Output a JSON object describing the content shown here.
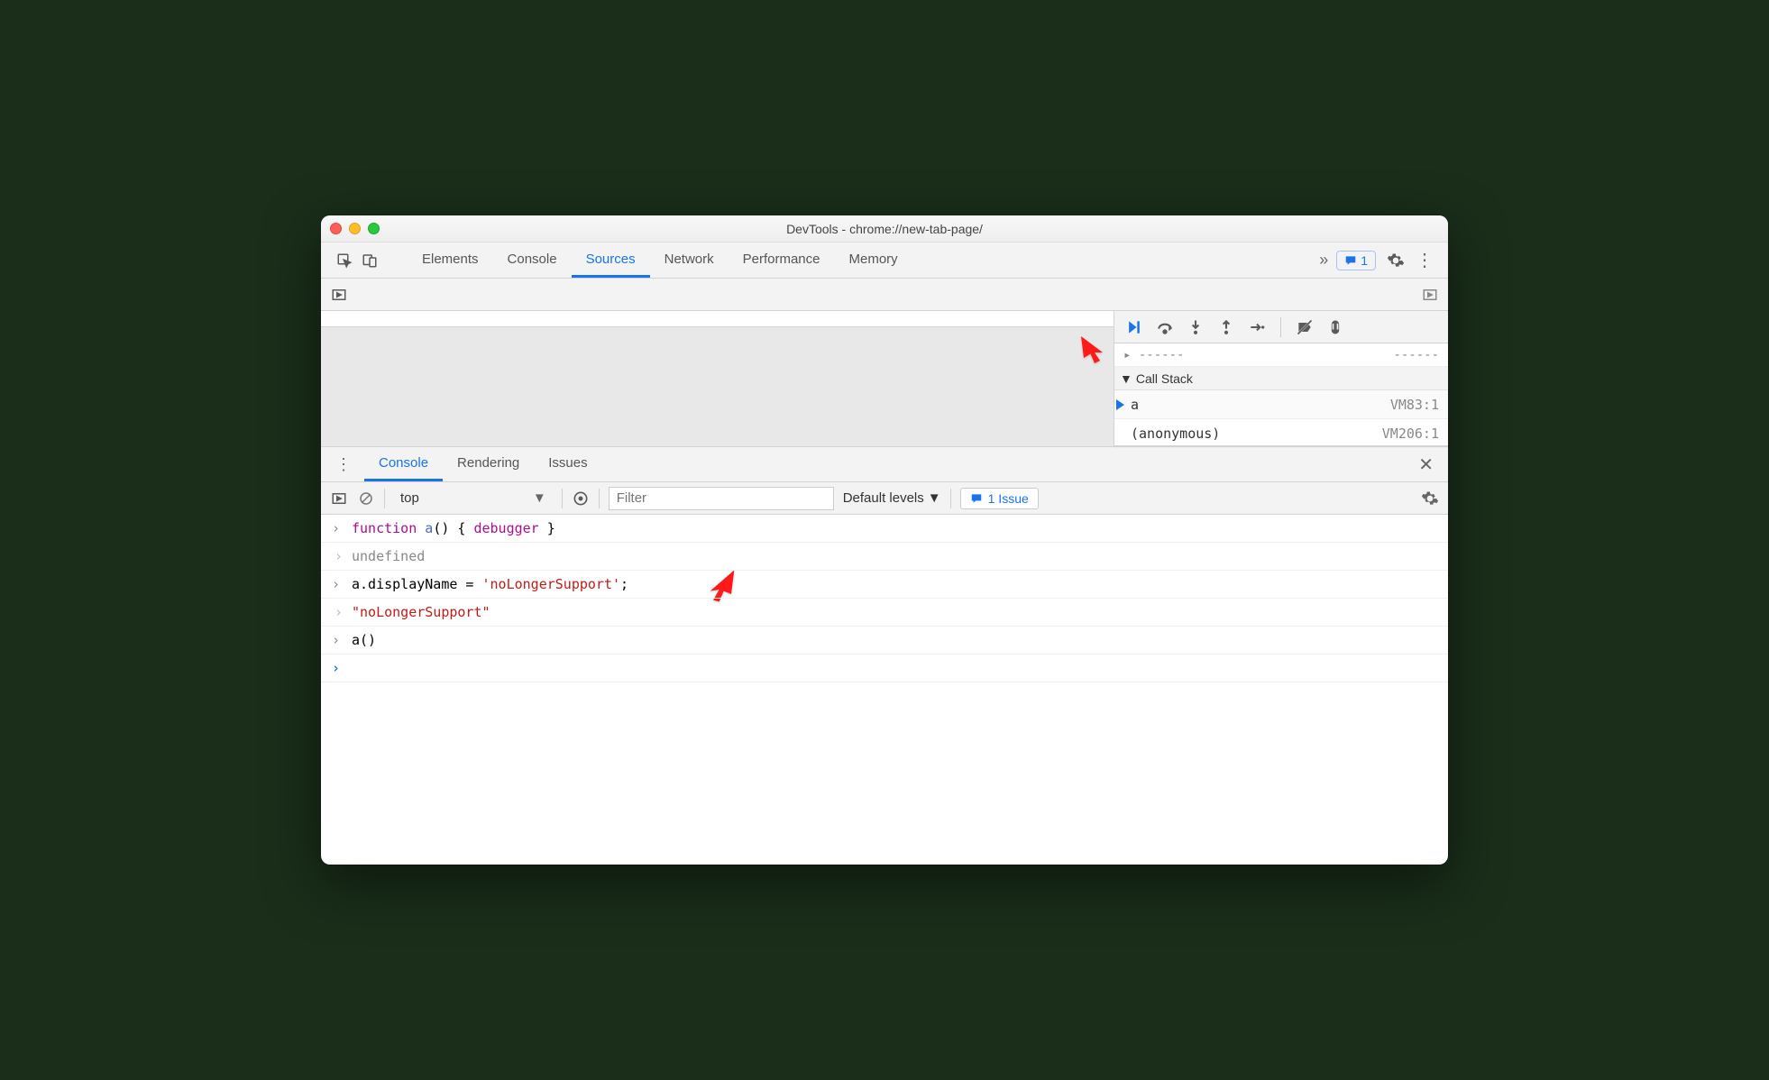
{
  "window": {
    "title": "DevTools - chrome://new-tab-page/"
  },
  "mainTabs": [
    "Elements",
    "Console",
    "Sources",
    "Network",
    "Performance",
    "Memory"
  ],
  "mainActiveIndex": 2,
  "issuesBadge": "1",
  "scope": {
    "partial_label_left": "…",
    "partial_label_right": "…"
  },
  "callStack": {
    "header": "Call Stack",
    "frames": [
      {
        "name": "a",
        "loc": "VM83:1",
        "active": true
      },
      {
        "name": "(anonymous)",
        "loc": "VM206:1",
        "active": false
      }
    ]
  },
  "drawerTabs": [
    "Console",
    "Rendering",
    "Issues"
  ],
  "drawerActiveIndex": 0,
  "consoleToolbar": {
    "context": "top",
    "filterPlaceholder": "Filter",
    "levels": "Default levels",
    "issue": "1 Issue"
  },
  "consoleLines": [
    {
      "type": "input",
      "segments": [
        {
          "t": "function ",
          "c": "kw"
        },
        {
          "t": "a",
          "c": "fn"
        },
        {
          "t": "() { ",
          "c": ""
        },
        {
          "t": "debugger",
          "c": "dbg"
        },
        {
          "t": " }",
          "c": ""
        }
      ]
    },
    {
      "type": "output",
      "segments": [
        {
          "t": "undefined",
          "c": "undef"
        }
      ]
    },
    {
      "type": "input",
      "segments": [
        {
          "t": "a.displayName = ",
          "c": ""
        },
        {
          "t": "'noLongerSupport'",
          "c": "str"
        },
        {
          "t": ";",
          "c": ""
        }
      ]
    },
    {
      "type": "output",
      "segments": [
        {
          "t": "\"noLongerSupport\"",
          "c": "str"
        }
      ]
    },
    {
      "type": "input",
      "segments": [
        {
          "t": "a()",
          "c": ""
        }
      ]
    },
    {
      "type": "prompt",
      "segments": []
    }
  ]
}
